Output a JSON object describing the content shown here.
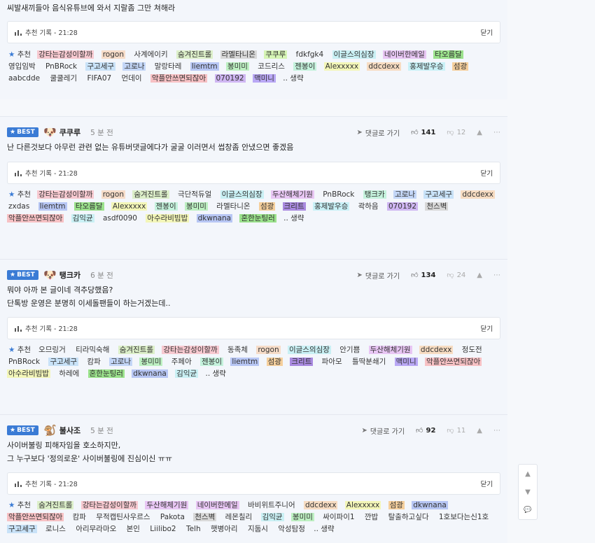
{
  "top": {
    "text": "씨발새끼들아 음식유튜브에 와서 지랄좀 그만 쳐해라",
    "box_label": "추천 기록 - 21:28",
    "close": "닫기",
    "lead": "추천",
    "tags": [
      {
        "t": "강타는감성이할까",
        "c": "#f7c9d0"
      },
      {
        "t": "rogon",
        "c": "#f6dcc8"
      },
      {
        "t": "사계에이키",
        "c": ""
      },
      {
        "t": "숨겨진트롤",
        "c": "#dcefc9"
      },
      {
        "t": "라멜타니온",
        "c": "#d8d8d8"
      },
      {
        "t": "쿠쿠루",
        "c": "#d6f5b5"
      },
      {
        "t": "fdkfgk4",
        "c": ""
      },
      {
        "t": "이글스의심장",
        "c": "#c9f0f4"
      },
      {
        "t": "네이버한메일",
        "c": "#e8c6f4"
      },
      {
        "t": "타오름달",
        "c": "#9be28c"
      },
      {
        "t": "영입임박",
        "c": ""
      },
      {
        "t": "PnBRock",
        "c": ""
      },
      {
        "t": "구고세구",
        "c": "#c8e2f8"
      },
      {
        "t": "고로나",
        "c": "#c3d6f7"
      },
      {
        "t": "말랑타레",
        "c": ""
      },
      {
        "t": "liemtm",
        "c": "#b7c6f4"
      },
      {
        "t": "봉미미",
        "c": "#bdf0c2"
      },
      {
        "t": "코드리스",
        "c": ""
      },
      {
        "t": "젠봉이",
        "c": "#c4f2dc"
      },
      {
        "t": "Alexxxxx",
        "c": "#f3f6b8"
      },
      {
        "t": "ddcdexx",
        "c": "#f7dcc2"
      },
      {
        "t": "홍제발우승",
        "c": "#c9f1f7"
      },
      {
        "t": "섬광",
        "c": "#f5cf9c"
      },
      {
        "t": "aabcdde",
        "c": ""
      },
      {
        "t": "쿨쿨레기",
        "c": ""
      },
      {
        "t": "FIFA07",
        "c": ""
      },
      {
        "t": "먼데이",
        "c": ""
      },
      {
        "t": "악플안쓰면되잖아",
        "c": "#f7c1c4"
      },
      {
        "t": "070192",
        "c": "#cfb6f2"
      },
      {
        "t": "맥미니",
        "c": "#b9a8f5"
      }
    ],
    "more": ".. 생략"
  },
  "comments": [
    {
      "badge": "BEST",
      "avatar": "🐶",
      "nick": "쿠쿠루",
      "ago": "5 분 전",
      "reply": "댓글로 가기",
      "likes": "141",
      "dislikes": "12",
      "text": "난 다른것보다 아무런 관련 없는 유튜버댓글에다가 굴굴 이러면서 썹창좀 안냈으면 좋겠음",
      "box_label": "추천 기록 - 21:28",
      "close": "닫기",
      "lead": "추천",
      "tags": [
        {
          "t": "강타는감성이할까",
          "c": "#f7c9d0"
        },
        {
          "t": "rogon",
          "c": "#f6dcc8"
        },
        {
          "t": "숨겨진트롤",
          "c": "#dcefc9"
        },
        {
          "t": "극단적듀얼",
          "c": ""
        },
        {
          "t": "이글스의심장",
          "c": "#c9f0f4"
        },
        {
          "t": "두산해체기원",
          "c": "#e8c6f4"
        },
        {
          "t": "PnBRock",
          "c": ""
        },
        {
          "t": "탱크카",
          "c": "#c4f2dc"
        },
        {
          "t": "고로나",
          "c": "#c3d6f7"
        },
        {
          "t": "구고세구",
          "c": "#c8e2f8"
        },
        {
          "t": "ddcdexx",
          "c": "#f7dcc2"
        },
        {
          "t": "zxdas",
          "c": ""
        },
        {
          "t": "liemtm",
          "c": "#b7c6f4"
        },
        {
          "t": "타오름달",
          "c": "#9be28c"
        },
        {
          "t": "Alexxxxx",
          "c": "#f3f6b8"
        },
        {
          "t": "젠봉이",
          "c": "#c4f2dc"
        },
        {
          "t": "봉미미",
          "c": "#bdf0c2"
        },
        {
          "t": "라멜타니온",
          "c": ""
        },
        {
          "t": "섬광",
          "c": "#f5cf9c"
        },
        {
          "t": "크리트",
          "c": "#a98ae0"
        },
        {
          "t": "홍제발우승",
          "c": "#c9f1f7"
        },
        {
          "t": "곽하음",
          "c": ""
        },
        {
          "t": "070192",
          "c": "#cfb6f2"
        },
        {
          "t": "천스벽",
          "c": "#d8d8d8"
        },
        {
          "t": "악플안쓰면되잖아",
          "c": "#f7c1c4"
        },
        {
          "t": "김익균",
          "c": "#c9f0f4"
        },
        {
          "t": "asdf0090",
          "c": ""
        },
        {
          "t": "아수라비빔밥",
          "c": "#f3f6b8"
        },
        {
          "t": "dkwnana",
          "c": "#b7c6f4"
        },
        {
          "t": "혼한눈팅러",
          "c": "#9be28c"
        }
      ],
      "more": ".. 생략"
    },
    {
      "badge": "BEST",
      "avatar": "🐶",
      "nick": "탱크카",
      "ago": "6 분 전",
      "reply": "댓글로 가기",
      "likes": "134",
      "dislikes": "24",
      "text": "뭐야 아까 본 글이네 격추당했음?\n단톡방 운영은 분명히 이세돌팬들이 하는거겠는데..",
      "box_label": "추천 기록 - 21:28",
      "close": "닫기",
      "lead": "추천",
      "tags": [
        {
          "t": "오므링거",
          "c": ""
        },
        {
          "t": "티라믹숙해",
          "c": ""
        },
        {
          "t": "숨겨진트롤",
          "c": "#dcefc9"
        },
        {
          "t": "강타는감성이할까",
          "c": "#f7c9d0"
        },
        {
          "t": "동족체",
          "c": ""
        },
        {
          "t": "rogon",
          "c": "#f6dcc8"
        },
        {
          "t": "이글스의심장",
          "c": "#c9f0f4"
        },
        {
          "t": "안기쁨",
          "c": ""
        },
        {
          "t": "두산해체기원",
          "c": "#e8c6f4"
        },
        {
          "t": "ddcdexx",
          "c": "#f7dcc2"
        },
        {
          "t": "정도전",
          "c": ""
        },
        {
          "t": "PnBRock",
          "c": ""
        },
        {
          "t": "구고세구",
          "c": "#c8e2f8"
        },
        {
          "t": "캄파",
          "c": ""
        },
        {
          "t": "고로나",
          "c": "#c3d6f7"
        },
        {
          "t": "봉미미",
          "c": "#bdf0c2"
        },
        {
          "t": "주페아",
          "c": ""
        },
        {
          "t": "젠봉이",
          "c": "#c4f2dc"
        },
        {
          "t": "liemtm",
          "c": "#b7c6f4"
        },
        {
          "t": "섬광",
          "c": "#f5cf9c"
        },
        {
          "t": "크리트",
          "c": "#a98ae0"
        },
        {
          "t": "파아모",
          "c": ""
        },
        {
          "t": "틀딱분쇄기",
          "c": ""
        },
        {
          "t": "맥미니",
          "c": "#b9a8f5"
        },
        {
          "t": "악플안쓰면되잖아",
          "c": "#f7c1c4"
        },
        {
          "t": "아수라비빔밥",
          "c": "#f3f6b8"
        },
        {
          "t": "하레에",
          "c": ""
        },
        {
          "t": "혼한눈팅러",
          "c": "#9be28c"
        },
        {
          "t": "dkwnana",
          "c": "#b7c6f4"
        },
        {
          "t": "김익균",
          "c": "#c9f0f4"
        }
      ],
      "more": ".. 생략"
    },
    {
      "badge": "BEST",
      "avatar": "🐒",
      "nick": "불사조",
      "ago": "5 분 전",
      "reply": "댓글로 가기",
      "likes": "92",
      "dislikes": "11",
      "text": "사이버불링 피해자임을 호소하지만,\n그 누구보다 '정의로운' 사이버불링에 진심이신 ㅠㅠ",
      "box_label": "추천 기록 - 21:28",
      "close": "닫기",
      "lead": "추천",
      "tags": [
        {
          "t": "숨겨진트롤",
          "c": "#dcefc9"
        },
        {
          "t": "강타는감성이할까",
          "c": "#f7c9d0"
        },
        {
          "t": "두산해체기원",
          "c": "#e8c6f4"
        },
        {
          "t": "네이버한메일",
          "c": "#e8c6f4"
        },
        {
          "t": "바비위트주니어",
          "c": ""
        },
        {
          "t": "ddcdexx",
          "c": "#f7dcc2"
        },
        {
          "t": "Alexxxxx",
          "c": "#f3f6b8"
        },
        {
          "t": "섬광",
          "c": "#f5cf9c"
        },
        {
          "t": "dkwnana",
          "c": "#b7c6f4"
        },
        {
          "t": "악플안쓰면되잖아",
          "c": "#f7c1c4"
        },
        {
          "t": "캄파",
          "c": ""
        },
        {
          "t": "무적캡틴사우르스",
          "c": ""
        },
        {
          "t": "Pakota",
          "c": ""
        },
        {
          "t": "천스벽",
          "c": "#d8d8d8"
        },
        {
          "t": "레몬칠리",
          "c": ""
        },
        {
          "t": "김익균",
          "c": "#c9f0f4"
        },
        {
          "t": "봉미미",
          "c": "#bdf0c2"
        },
        {
          "t": "싸이파이1",
          "c": ""
        },
        {
          "t": "깐밥",
          "c": ""
        },
        {
          "t": "탈출하고싶다",
          "c": ""
        },
        {
          "t": "1호보다는신1호",
          "c": ""
        },
        {
          "t": "구고세구",
          "c": "#c8e2f8"
        },
        {
          "t": "로니스",
          "c": ""
        },
        {
          "t": "아리무라마오",
          "c": ""
        },
        {
          "t": "본인",
          "c": ""
        },
        {
          "t": "Liilibo2",
          "c": ""
        },
        {
          "t": "Telh",
          "c": ""
        },
        {
          "t": "햇병아리",
          "c": ""
        },
        {
          "t": "지둡시",
          "c": ""
        },
        {
          "t": "악성탐정",
          "c": ""
        }
      ],
      "more": ".. 생략"
    }
  ],
  "fab": {
    "up": "▲",
    "down": "▼",
    "comment": "💬"
  }
}
